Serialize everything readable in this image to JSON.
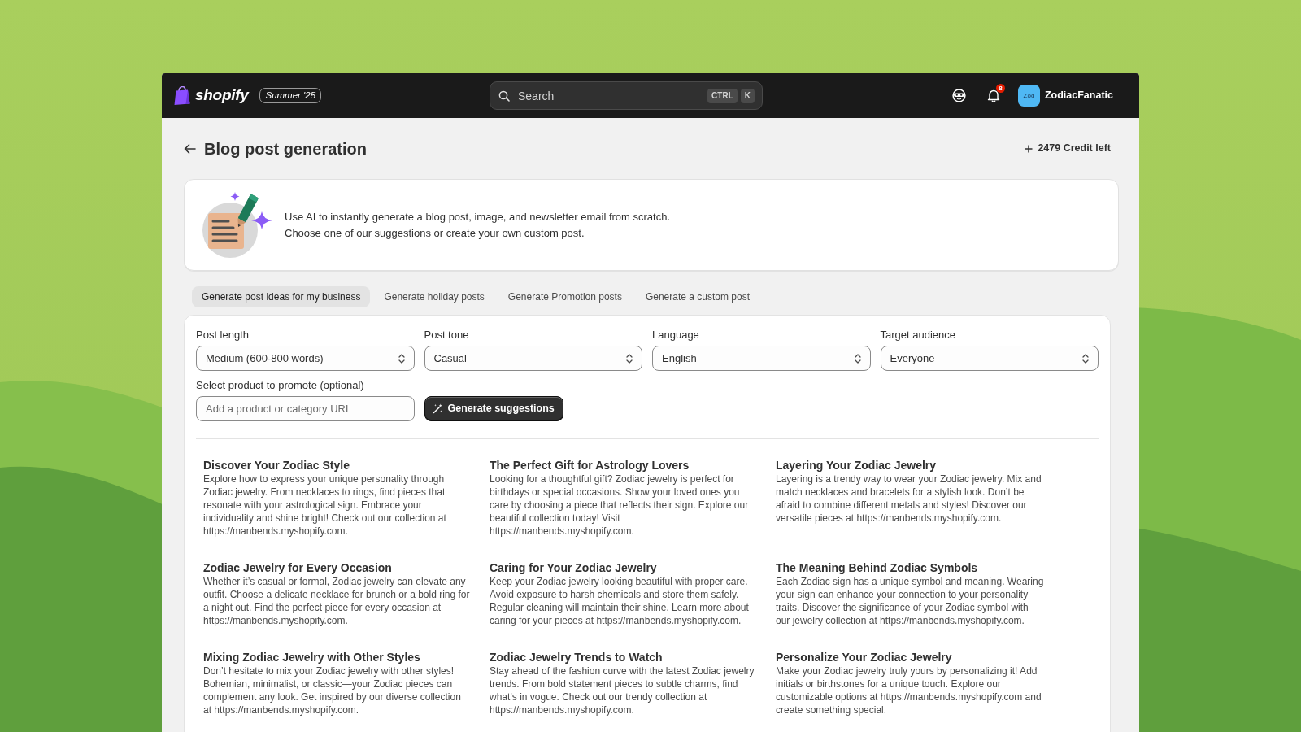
{
  "topbar": {
    "logo_text": "shopify",
    "edition_badge": "Summer '25",
    "search": {
      "placeholder": "Search",
      "shortcut_keys": [
        "CTRL",
        "K"
      ]
    },
    "notification_count": "8",
    "account": {
      "avatar_initials": "Zod",
      "name": "ZodiacFanatic"
    }
  },
  "header": {
    "title": "Blog post generation",
    "credits": "2479 Credit left"
  },
  "intro": {
    "lines": [
      "Use AI to instantly generate a blog post, image, and newsletter email from scratch.",
      "Choose one of our suggestions or create your own custom post."
    ]
  },
  "tabs": [
    {
      "label": "Generate post ideas for my business",
      "selected": true
    },
    {
      "label": "Generate holiday posts",
      "selected": false
    },
    {
      "label": "Generate Promotion posts",
      "selected": false
    },
    {
      "label": "Generate a custom post",
      "selected": false
    }
  ],
  "form": {
    "fields": [
      {
        "kind": "select",
        "label": "Post length",
        "value": "Medium (600-800 words)"
      },
      {
        "kind": "select",
        "label": "Post tone",
        "value": "Casual"
      },
      {
        "kind": "select",
        "label": "Language",
        "value": "English"
      },
      {
        "kind": "select",
        "label": "Target audience",
        "value": "Everyone"
      },
      {
        "kind": "text",
        "label": "Select product to promote (optional)",
        "placeholder": "Add a product or category URL"
      }
    ],
    "generate_button": "Generate suggestions"
  },
  "suggestions": [
    {
      "title": "Discover Your Zodiac Style",
      "body": "Explore how to express your unique personality through Zodiac jewelry. From necklaces to rings, find pieces that resonate with your astrological sign. Embrace your individuality and shine bright! Check out our collection at https://manbends.myshopify.com."
    },
    {
      "title": "The Perfect Gift for Astrology Lovers",
      "body": "Looking for a thoughtful gift? Zodiac jewelry is perfect for birthdays or special occasions. Show your loved ones you care by choosing a piece that reflects their sign. Explore our beautiful collection today! Visit https://manbends.myshopify.com."
    },
    {
      "title": "Layering Your Zodiac Jewelry",
      "body": "Layering is a trendy way to wear your Zodiac jewelry. Mix and match necklaces and bracelets for a stylish look. Don’t be afraid to combine different metals and styles! Discover our versatile pieces at https://manbends.myshopify.com."
    },
    {
      "title": "Zodiac Jewelry for Every Occasion",
      "body": "Whether it’s casual or formal, Zodiac jewelry can elevate any outfit. Choose a delicate necklace for brunch or a bold ring for a night out. Find the perfect piece for every occasion at https://manbends.myshopify.com."
    },
    {
      "title": "Caring for Your Zodiac Jewelry",
      "body": "Keep your Zodiac jewelry looking beautiful with proper care. Avoid exposure to harsh chemicals and store them safely. Regular cleaning will maintain their shine. Learn more about caring for your pieces at https://manbends.myshopify.com."
    },
    {
      "title": "The Meaning Behind Zodiac Symbols",
      "body": "Each Zodiac sign has a unique symbol and meaning. Wearing your sign can enhance your connection to your personality traits. Discover the significance of your Zodiac symbol with our jewelry collection at https://manbends.myshopify.com."
    },
    {
      "title": "Mixing Zodiac Jewelry with Other Styles",
      "body": "Don’t hesitate to mix your Zodiac jewelry with other styles! Bohemian, minimalist, or classic—your Zodiac pieces can complement any look. Get inspired by our diverse collection at https://manbends.myshopify.com."
    },
    {
      "title": "Zodiac Jewelry Trends to Watch",
      "body": "Stay ahead of the fashion curve with the latest Zodiac jewelry trends. From bold statement pieces to subtle charms, find what’s in vogue. Check out our trendy collection at https://manbends.myshopify.com."
    },
    {
      "title": "Personalize Your Zodiac Jewelry",
      "body": "Make your Zodiac jewelry truly yours by personalizing it! Add initials or birthstones for a unique touch. Explore our customizable options at https://manbends.myshopify.com and create something special."
    }
  ]
}
